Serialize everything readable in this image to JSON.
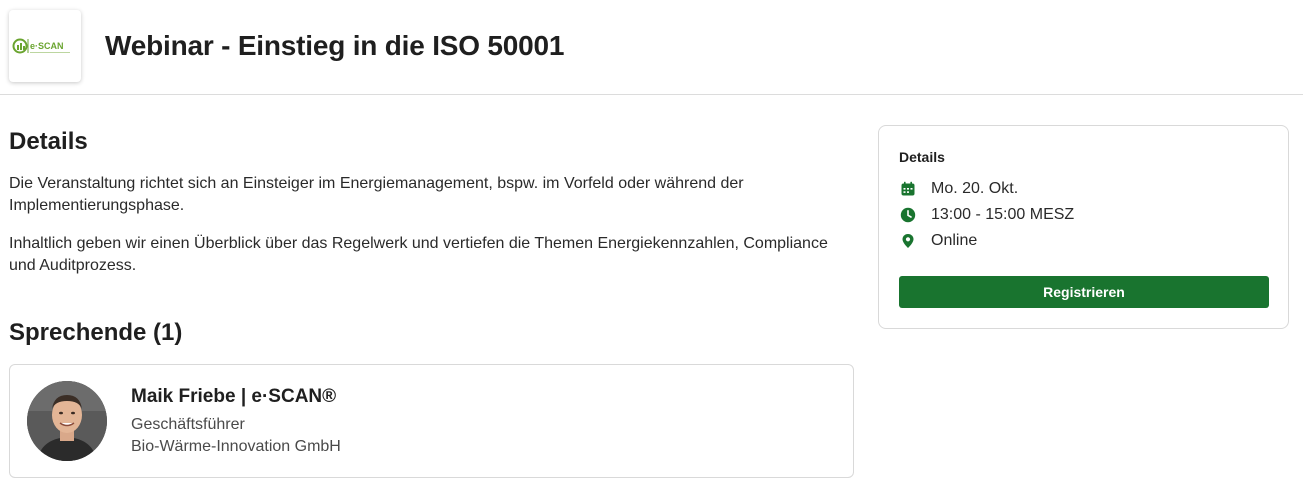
{
  "header": {
    "title": "Webinar - Einstieg in die ISO 50001",
    "logo": {
      "text": "e·SCAN",
      "icon": "escan-logo"
    }
  },
  "details": {
    "heading": "Details",
    "paragraphs": [
      "Die Veranstaltung richtet sich an Einsteiger im Energiemanagement, bspw. im Vorfeld oder während der Implementierungsphase.",
      "Inhaltlich geben wir einen Überblick über das Regelwerk und vertiefen die Themen Energiekennzahlen, Compliance und Auditprozess."
    ]
  },
  "speakers": {
    "heading": "Sprechende (1)",
    "items": [
      {
        "name": "Maik Friebe | e·SCAN®",
        "role": "Geschäftsführer",
        "company": "Bio-Wärme-Innovation GmbH"
      }
    ]
  },
  "sidebar": {
    "heading": "Details",
    "date": "Mo. 20. Okt.",
    "time": "13:00 - 15:00 MESZ",
    "location": "Online",
    "register_label": "Registrieren",
    "icons": [
      "calendar-icon",
      "clock-icon",
      "location-pin-icon"
    ]
  },
  "colors": {
    "accent": "#19742f",
    "logo_green": "#6aa42f"
  }
}
